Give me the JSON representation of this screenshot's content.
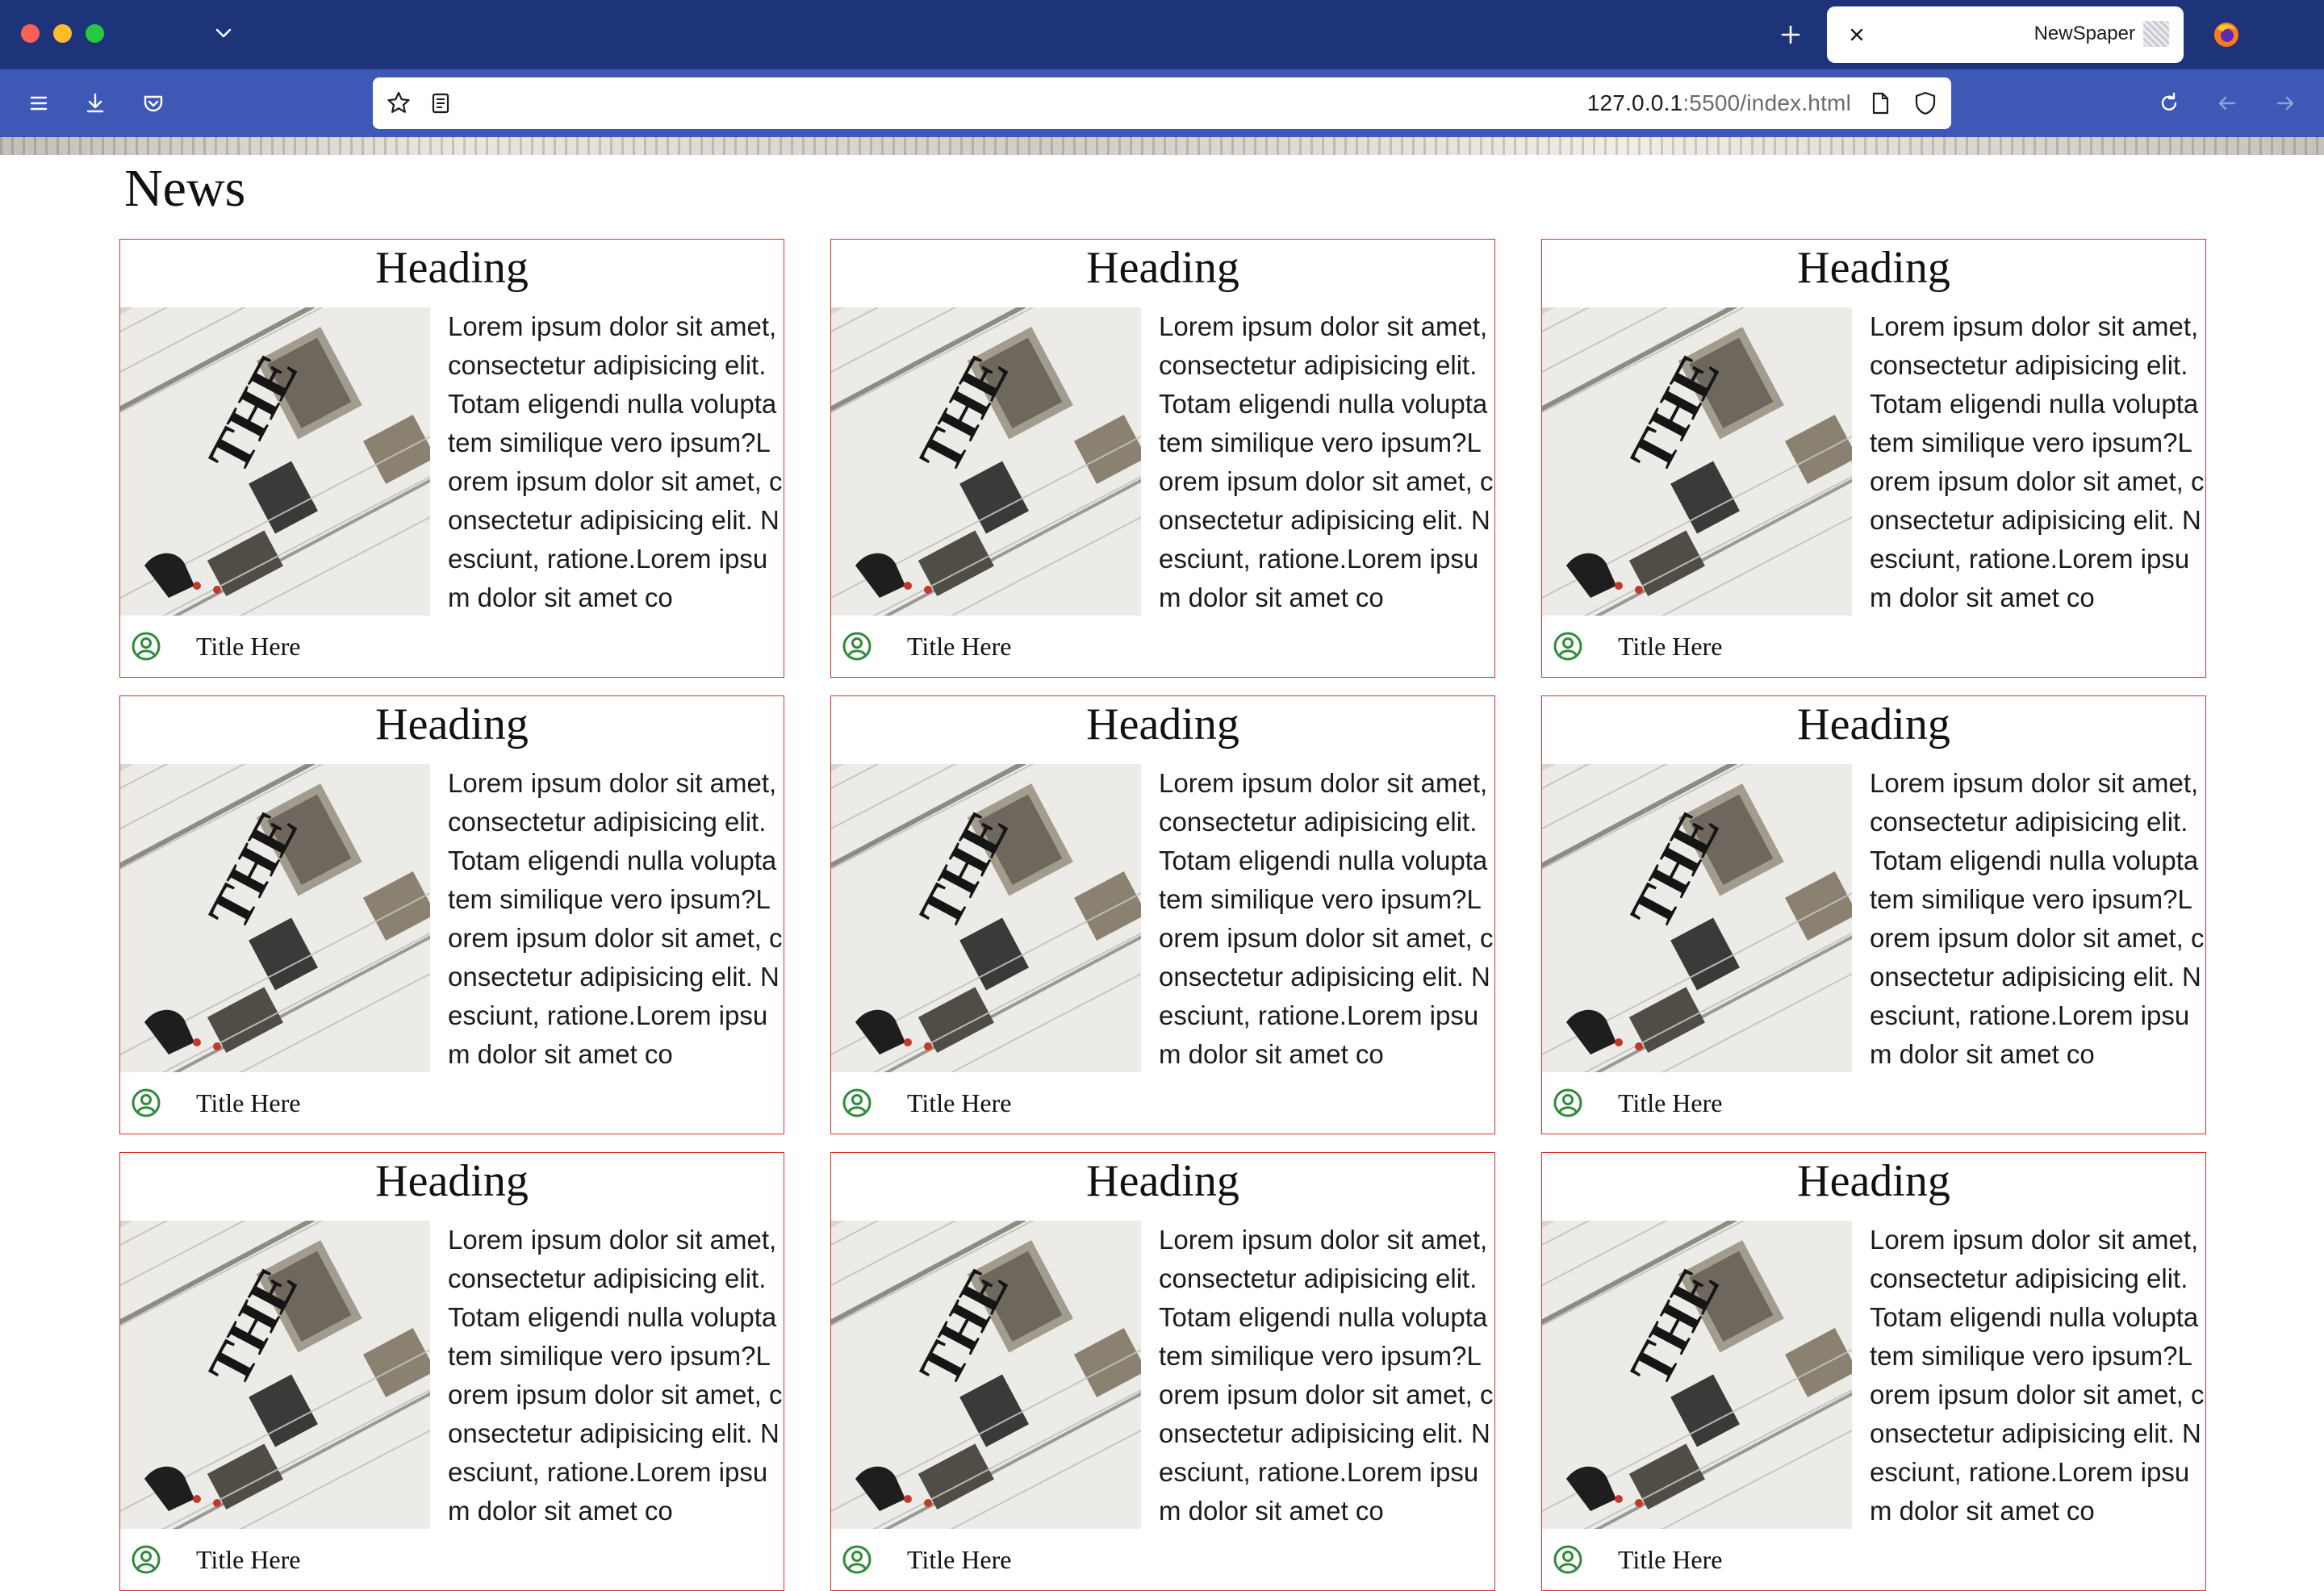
{
  "browser": {
    "tab": {
      "title": "NewSpaper",
      "favicon": "newspaper-favicon"
    },
    "url": {
      "host": "127.0.0.1",
      "rest": ":5500/index.html"
    },
    "accent_titlebar": "#1e347a",
    "accent_toolbar": "#3d59b5"
  },
  "page": {
    "title": "News",
    "cards": [
      {
        "heading": "Heading",
        "text": "Lorem ipsum dolor sit amet, consectetur adipisicing elit. Totam eligendi nulla voluptatem similique vero ipsum?Lorem ipsum dolor sit amet, consectetur adipisicing elit. Nesciunt, ratione.Lorem ipsum dolor sit amet co",
        "footer": "Title Here"
      },
      {
        "heading": "Heading",
        "text": "Lorem ipsum dolor sit amet, consectetur adipisicing elit. Totam eligendi nulla voluptatem similique vero ipsum?Lorem ipsum dolor sit amet, consectetur adipisicing elit. Nesciunt, ratione.Lorem ipsum dolor sit amet co",
        "footer": "Title Here"
      },
      {
        "heading": "Heading",
        "text": "Lorem ipsum dolor sit amet, consectetur adipisicing elit. Totam eligendi nulla voluptatem similique vero ipsum?Lorem ipsum dolor sit amet, consectetur adipisicing elit. Nesciunt, ratione.Lorem ipsum dolor sit amet co",
        "footer": "Title Here"
      },
      {
        "heading": "Heading",
        "text": "Lorem ipsum dolor sit amet, consectetur adipisicing elit. Totam eligendi nulla voluptatem similique vero ipsum?Lorem ipsum dolor sit amet, consectetur adipisicing elit. Nesciunt, ratione.Lorem ipsum dolor sit amet co",
        "footer": "Title Here"
      },
      {
        "heading": "Heading",
        "text": "Lorem ipsum dolor sit amet, consectetur adipisicing elit. Totam eligendi nulla voluptatem similique vero ipsum?Lorem ipsum dolor sit amet, consectetur adipisicing elit. Nesciunt, ratione.Lorem ipsum dolor sit amet co",
        "footer": "Title Here"
      },
      {
        "heading": "Heading",
        "text": "Lorem ipsum dolor sit amet, consectetur adipisicing elit. Totam eligendi nulla voluptatem similique vero ipsum?Lorem ipsum dolor sit amet, consectetur adipisicing elit. Nesciunt, ratione.Lorem ipsum dolor sit amet co",
        "footer": "Title Here"
      },
      {
        "heading": "Heading",
        "text": "Lorem ipsum dolor sit amet, consectetur adipisicing elit. Totam eligendi nulla voluptatem similique vero ipsum?Lorem ipsum dolor sit amet, consectetur adipisicing elit. Nesciunt, ratione.Lorem ipsum dolor sit amet co",
        "footer": "Title Here"
      },
      {
        "heading": "Heading",
        "text": "Lorem ipsum dolor sit amet, consectetur adipisicing elit. Totam eligendi nulla voluptatem similique vero ipsum?Lorem ipsum dolor sit amet, consectetur adipisicing elit. Nesciunt, ratione.Lorem ipsum dolor sit amet co",
        "footer": "Title Here"
      },
      {
        "heading": "Heading",
        "text": "Lorem ipsum dolor sit amet, consectetur adipisicing elit. Totam eligendi nulla voluptatem similique vero ipsum?Lorem ipsum dolor sit amet, consectetur adipisicing elit. Nesciunt, ratione.Lorem ipsum dolor sit amet co",
        "footer": "Title Here"
      }
    ],
    "card_border_color": "#d9302b",
    "user_icon_color": "#2e8b3a",
    "card_image": {
      "name": "newspaper-photo",
      "headline_fragment": "THE"
    }
  }
}
